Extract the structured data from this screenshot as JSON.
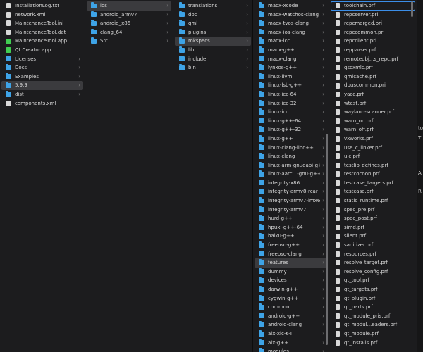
{
  "colors": {
    "folder": "#3ea3e6",
    "selection": "#3b3b3e",
    "focus": "#3b8ee8",
    "qt": "#41cd52"
  },
  "col1": [
    {
      "label": "InstallationLog.txt",
      "icon": "file"
    },
    {
      "label": "network.xml",
      "icon": "file"
    },
    {
      "label": "MaintenanceTool.ini",
      "icon": "file"
    },
    {
      "label": "MaintenanceTool.dat",
      "icon": "file"
    },
    {
      "label": "MaintenanceTool.app",
      "icon": "app"
    },
    {
      "label": "Qt Creator.app",
      "icon": "app"
    },
    {
      "label": "Licenses",
      "icon": "folder",
      "chevron": "›"
    },
    {
      "label": "Docs",
      "icon": "folder",
      "chevron": "›"
    },
    {
      "label": "Examples",
      "icon": "folder",
      "chevron": "›"
    },
    {
      "label": "5.9.9",
      "icon": "folder",
      "chevron": "›",
      "selected": true
    },
    {
      "label": "dist",
      "icon": "folder",
      "chevron": "›"
    },
    {
      "label": "components.xml",
      "icon": "file"
    }
  ],
  "col2": [
    {
      "label": "ios",
      "icon": "folder",
      "chevron": "›",
      "selected": true
    },
    {
      "label": "android_armv7",
      "icon": "folder",
      "chevron": "›"
    },
    {
      "label": "android_x86",
      "icon": "folder",
      "chevron": "›"
    },
    {
      "label": "clang_64",
      "icon": "folder",
      "chevron": "›"
    },
    {
      "label": "Src",
      "icon": "folder",
      "chevron": "›"
    }
  ],
  "col3": [
    {
      "label": "translations",
      "icon": "folder",
      "chevron": "›"
    },
    {
      "label": "doc",
      "icon": "folder",
      "chevron": "›"
    },
    {
      "label": "qml",
      "icon": "folder",
      "chevron": "›"
    },
    {
      "label": "plugins",
      "icon": "folder",
      "chevron": "›"
    },
    {
      "label": "mkspecs",
      "icon": "folder",
      "chevron": "›",
      "selected": true
    },
    {
      "label": "lib",
      "icon": "folder",
      "chevron": "›"
    },
    {
      "label": "include",
      "icon": "folder",
      "chevron": "›"
    },
    {
      "label": "bin",
      "icon": "folder",
      "chevron": "›"
    }
  ],
  "col4": [
    {
      "label": "macx-xcode",
      "icon": "folder",
      "chevron": "›"
    },
    {
      "label": "macx-watchos-clang",
      "icon": "folder",
      "chevron": "›"
    },
    {
      "label": "macx-tvos-clang",
      "icon": "folder",
      "chevron": "›"
    },
    {
      "label": "macx-ios-clang",
      "icon": "folder",
      "chevron": "›"
    },
    {
      "label": "macx-icc",
      "icon": "folder",
      "chevron": "›"
    },
    {
      "label": "macx-g++",
      "icon": "folder",
      "chevron": "›"
    },
    {
      "label": "macx-clang",
      "icon": "folder",
      "chevron": "›"
    },
    {
      "label": "lynxos-g++",
      "icon": "folder",
      "chevron": "›"
    },
    {
      "label": "linux-llvm",
      "icon": "folder",
      "chevron": "›"
    },
    {
      "label": "linux-lsb-g++",
      "icon": "folder",
      "chevron": "›"
    },
    {
      "label": "linux-icc-64",
      "icon": "folder",
      "chevron": "›"
    },
    {
      "label": "linux-icc-32",
      "icon": "folder",
      "chevron": "›"
    },
    {
      "label": "linux-icc",
      "icon": "folder",
      "chevron": "›"
    },
    {
      "label": "linux-g++-64",
      "icon": "folder",
      "chevron": "›"
    },
    {
      "label": "linux-g++-32",
      "icon": "folder",
      "chevron": "›"
    },
    {
      "label": "linux-g++",
      "icon": "folder",
      "chevron": "›"
    },
    {
      "label": "linux-clang-libc++",
      "icon": "folder",
      "chevron": "›"
    },
    {
      "label": "linux-clang",
      "icon": "folder",
      "chevron": "›"
    },
    {
      "label": "linux-arm-gnueabi-g++",
      "icon": "folder",
      "chevron": "›"
    },
    {
      "label": "linux-aarc...-gnu-g++",
      "icon": "folder",
      "chevron": "›"
    },
    {
      "label": "integrity-x86",
      "icon": "folder",
      "chevron": "›"
    },
    {
      "label": "integrity-armv8-rcar",
      "icon": "folder",
      "chevron": "›"
    },
    {
      "label": "integrity-armv7-imx6",
      "icon": "folder",
      "chevron": "›"
    },
    {
      "label": "integrity-armv7",
      "icon": "folder",
      "chevron": "›"
    },
    {
      "label": "hurd-g++",
      "icon": "folder",
      "chevron": "›"
    },
    {
      "label": "hpuxi-g++-64",
      "icon": "folder",
      "chevron": "›"
    },
    {
      "label": "haiku-g++",
      "icon": "folder",
      "chevron": "›"
    },
    {
      "label": "freebsd-g++",
      "icon": "folder",
      "chevron": "›"
    },
    {
      "label": "freebsd-clang",
      "icon": "folder",
      "chevron": "›"
    },
    {
      "label": "features",
      "icon": "folder",
      "chevron": "›",
      "selected": true
    },
    {
      "label": "dummy",
      "icon": "folder",
      "chevron": "›"
    },
    {
      "label": "devices",
      "icon": "folder",
      "chevron": "›"
    },
    {
      "label": "darwin-g++",
      "icon": "folder",
      "chevron": "›"
    },
    {
      "label": "cygwin-g++",
      "icon": "folder",
      "chevron": "›"
    },
    {
      "label": "common",
      "icon": "folder",
      "chevron": "›"
    },
    {
      "label": "android-g++",
      "icon": "folder",
      "chevron": "›"
    },
    {
      "label": "android-clang",
      "icon": "folder",
      "chevron": "›"
    },
    {
      "label": "aix-xlc-64",
      "icon": "folder",
      "chevron": "›"
    },
    {
      "label": "aix-g++",
      "icon": "folder",
      "chevron": "›"
    },
    {
      "label": "modules",
      "icon": "folder",
      "chevron": "›"
    }
  ],
  "col5": [
    {
      "label": "toolchain.prf",
      "icon": "file",
      "focused": true
    },
    {
      "label": "repcserver.pri",
      "icon": "file"
    },
    {
      "label": "repcmerged.pri",
      "icon": "file"
    },
    {
      "label": "repccommon.pri",
      "icon": "file"
    },
    {
      "label": "repcclient.pri",
      "icon": "file"
    },
    {
      "label": "repparser.prf",
      "icon": "file"
    },
    {
      "label": "remoteobj...s_repc.prf",
      "icon": "file"
    },
    {
      "label": "qscxmlc.prf",
      "icon": "file"
    },
    {
      "label": "qmlcache.prf",
      "icon": "file"
    },
    {
      "label": "dbuscommon.pri",
      "icon": "file"
    },
    {
      "label": "yacc.prf",
      "icon": "file"
    },
    {
      "label": "wtest.prf",
      "icon": "file"
    },
    {
      "label": "wayland-scanner.prf",
      "icon": "file"
    },
    {
      "label": "warn_on.prf",
      "icon": "file"
    },
    {
      "label": "warn_off.prf",
      "icon": "file"
    },
    {
      "label": "vxworks.prf",
      "icon": "file"
    },
    {
      "label": "use_c_linker.prf",
      "icon": "file"
    },
    {
      "label": "uic.prf",
      "icon": "file"
    },
    {
      "label": "testlib_defines.prf",
      "icon": "file"
    },
    {
      "label": "testcocoon.prf",
      "icon": "file"
    },
    {
      "label": "testcase_targets.prf",
      "icon": "file"
    },
    {
      "label": "testcase.prf",
      "icon": "file"
    },
    {
      "label": "static_runtime.prf",
      "icon": "file"
    },
    {
      "label": "spec_pre.prf",
      "icon": "file"
    },
    {
      "label": "spec_post.prf",
      "icon": "file"
    },
    {
      "label": "simd.prf",
      "icon": "file"
    },
    {
      "label": "silent.prf",
      "icon": "file"
    },
    {
      "label": "sanitizer.prf",
      "icon": "file"
    },
    {
      "label": "resources.prf",
      "icon": "file"
    },
    {
      "label": "resolve_target.prf",
      "icon": "file"
    },
    {
      "label": "resolve_config.prf",
      "icon": "file"
    },
    {
      "label": "qt_tool.prf",
      "icon": "file"
    },
    {
      "label": "qt_targets.prf",
      "icon": "file"
    },
    {
      "label": "qt_plugin.prf",
      "icon": "file"
    },
    {
      "label": "qt_parts.prf",
      "icon": "file"
    },
    {
      "label": "qt_module_pris.prf",
      "icon": "file"
    },
    {
      "label": "qt_modul...eaders.prf",
      "icon": "file"
    },
    {
      "label": "qt_module.prf",
      "icon": "file"
    },
    {
      "label": "qt_installs.prf",
      "icon": "file"
    }
  ],
  "right_pane": [
    "to",
    "T",
    "A",
    "R"
  ]
}
